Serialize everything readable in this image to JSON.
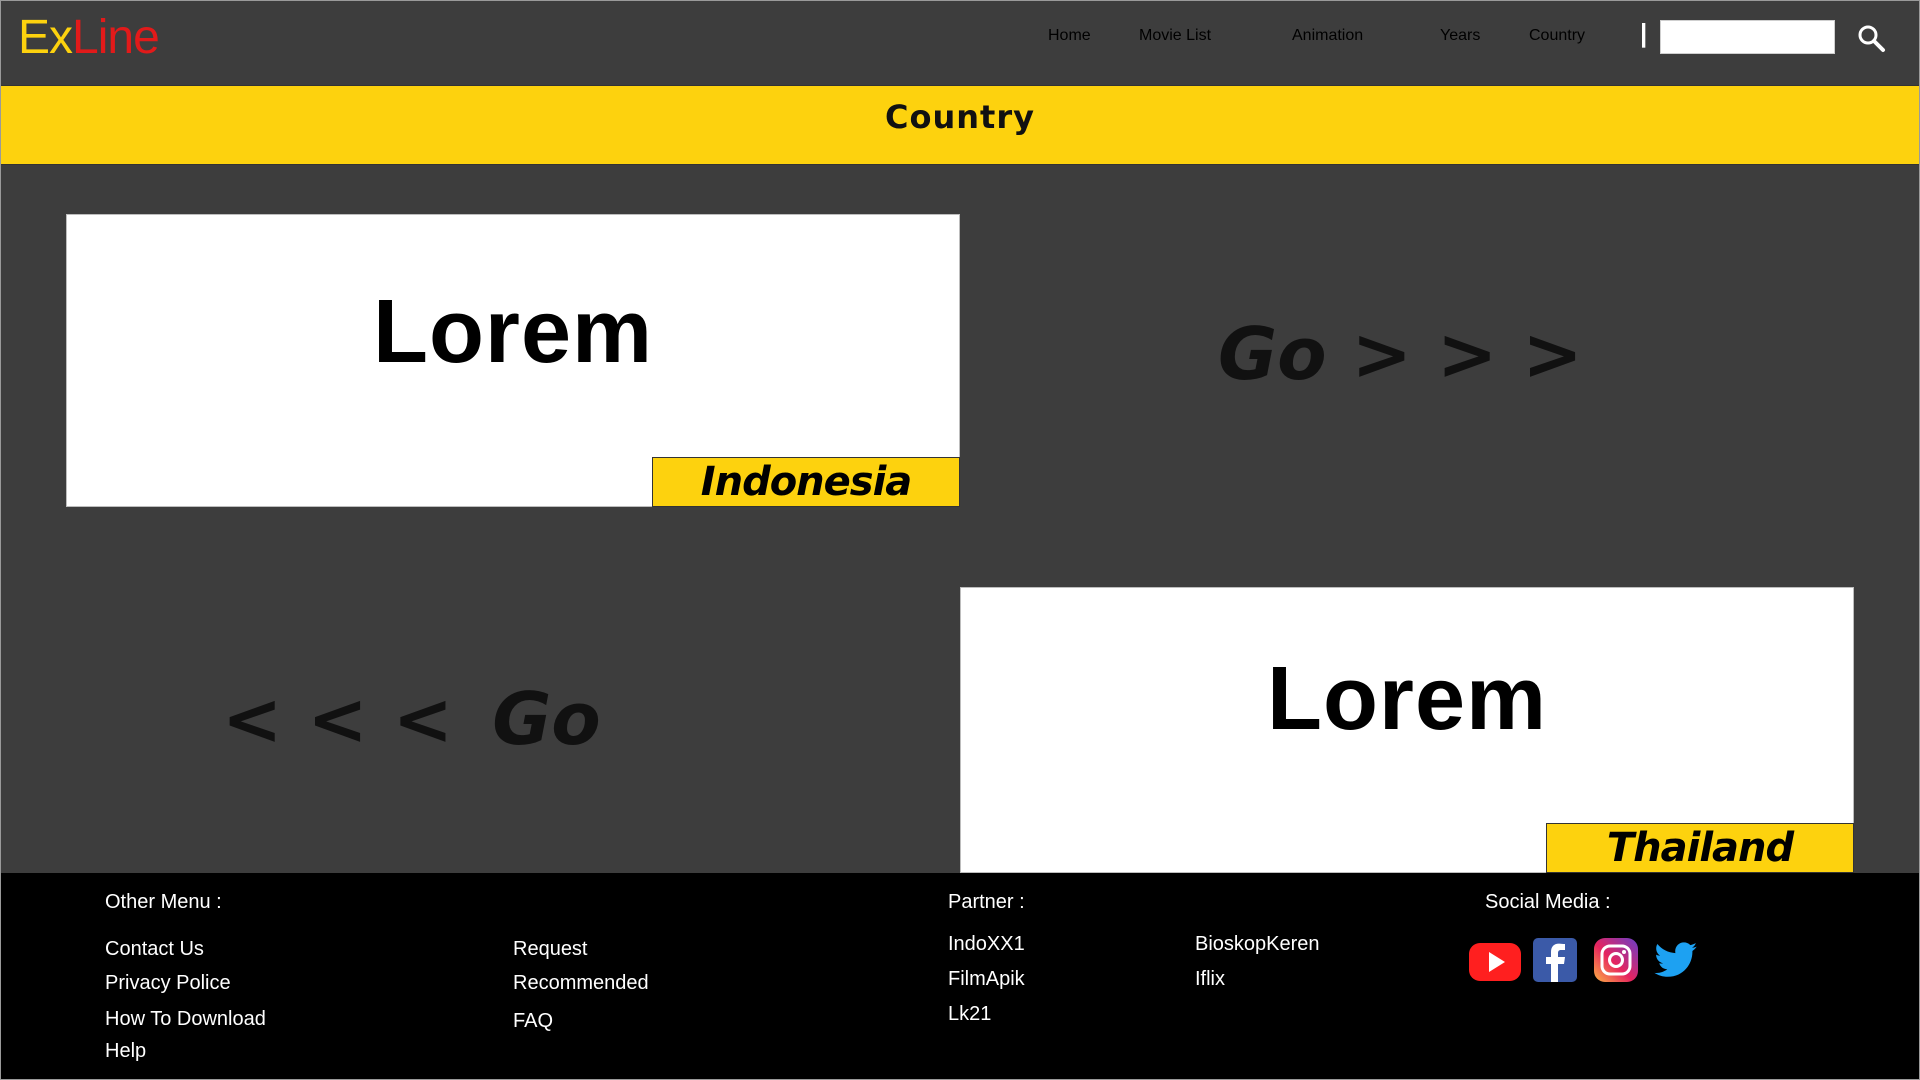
{
  "brand": {
    "ex": "Ex",
    "line": "Line"
  },
  "nav": {
    "items": [
      {
        "label": "Home"
      },
      {
        "label": "Movie List"
      },
      {
        "label": "Animation"
      },
      {
        "label": "Years"
      },
      {
        "label": "Country"
      }
    ],
    "separator": "|",
    "search": {
      "value": "",
      "placeholder": "",
      "icon": "search-icon"
    }
  },
  "banner": {
    "title": "Country"
  },
  "cards": [
    {
      "title": "Lorem",
      "country": "Indonesia"
    },
    {
      "title": "Lorem",
      "country": "Thailand"
    }
  ],
  "navigation": {
    "next": {
      "go": "Go",
      "arrows": "> > >"
    },
    "prev": {
      "arrows": "< < <",
      "go": "Go"
    }
  },
  "footer": {
    "other_menu": {
      "heading": "Other Menu :",
      "col1": [
        "Contact Us",
        "Privacy Police",
        "How To Download",
        "Help"
      ],
      "col2": [
        "Request",
        "Recommended",
        "FAQ"
      ]
    },
    "partner": {
      "heading": "Partner :",
      "col1": [
        "IndoXX1",
        "FilmApik",
        "Lk21"
      ],
      "col2": [
        "BioskopKeren",
        "Iflix"
      ]
    },
    "social": {
      "heading": "Social Media :",
      "icons": [
        "youtube-icon",
        "facebook-icon",
        "instagram-icon",
        "twitter-icon"
      ]
    }
  },
  "colors": {
    "accent": "#fdd20e",
    "brand_red": "#e21a1a",
    "background": "#3d3d3d",
    "footer": "#000000"
  }
}
